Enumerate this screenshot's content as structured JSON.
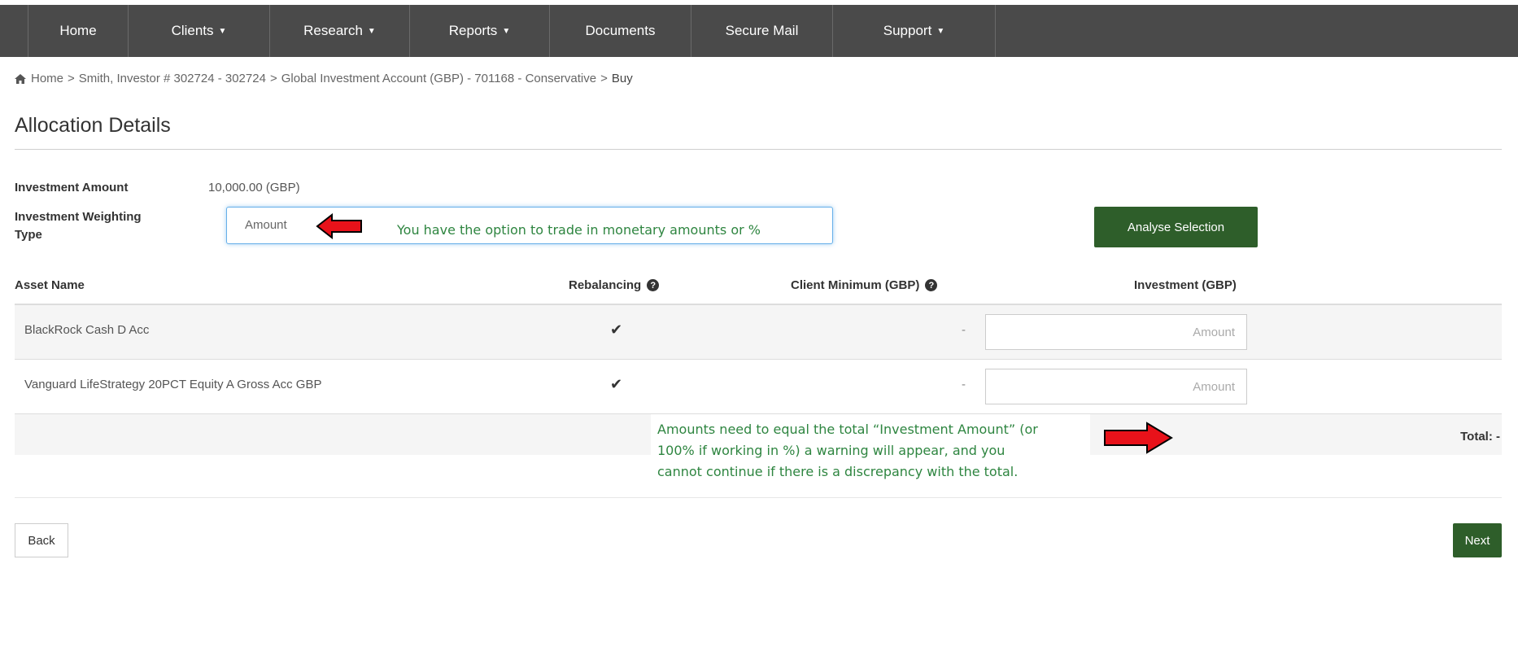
{
  "nav": {
    "items": [
      {
        "label": "Home",
        "caret": false
      },
      {
        "label": "Clients",
        "caret": true
      },
      {
        "label": "Research",
        "caret": true
      },
      {
        "label": "Reports",
        "caret": true
      },
      {
        "label": "Documents",
        "caret": false
      },
      {
        "label": "Secure Mail",
        "caret": false
      },
      {
        "label": "Support",
        "caret": true
      }
    ]
  },
  "breadcrumb": {
    "icon": "home-icon",
    "items": [
      "Home",
      "Smith, Investor # 302724 - 302724",
      "Global Investment Account (GBP) - 701168 - Conservative",
      "Buy"
    ],
    "separator": ">"
  },
  "page": {
    "title": "Allocation Details"
  },
  "form": {
    "investment_amount_label": "Investment Amount",
    "investment_amount_value": "10,000.00 (GBP)",
    "weighting_type_label_1": "Investment Weighting",
    "weighting_type_label_2": "Type",
    "weighting_type_value": "Amount",
    "analyse_button": "Analyse Selection"
  },
  "annotations": {
    "weighting_note": "You have the option to trade in monetary amounts or %",
    "total_note_1": "Amounts need to equal the total “Investment Amount” (or",
    "total_note_2": "100% if working in %) a warning will appear, and you",
    "total_note_3": "cannot continue if there is a discrepancy with the total.",
    "arrow_color": "#e8121a",
    "note_color": "#2e8540"
  },
  "table": {
    "headers": {
      "asset_name": "Asset Name",
      "rebalancing": "Rebalancing",
      "client_minimum": "Client Minimum (GBP)",
      "investment": "Investment (GBP)"
    },
    "rows": [
      {
        "name": "BlackRock Cash D Acc",
        "rebalancing": "✔",
        "client_minimum": "-",
        "investment_placeholder": "Amount"
      },
      {
        "name": "Vanguard LifeStrategy 20PCT Equity A Gross Acc GBP",
        "rebalancing": "✔",
        "client_minimum": "-",
        "investment_placeholder": "Amount"
      }
    ],
    "total_label": "Total: -"
  },
  "footer": {
    "back_button": "Back",
    "next_button": "Next"
  },
  "colors": {
    "nav_bg": "#4a4a4a",
    "primary_button": "#2e5e2a"
  }
}
